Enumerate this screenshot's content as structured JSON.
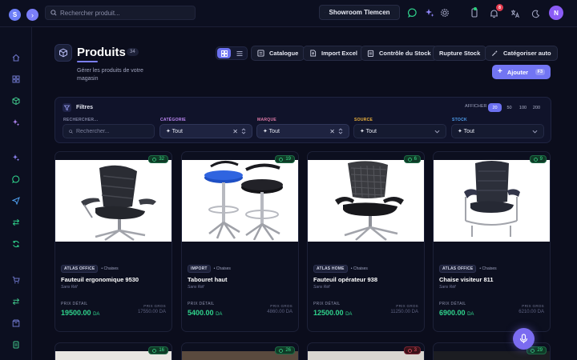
{
  "topbar": {
    "avatar_initial": "S",
    "search_placeholder": "Rechercher produit...",
    "showroom": "Showroom Tlemcen",
    "notifications_count": "8",
    "user_initial": "N"
  },
  "header": {
    "title": "Produits",
    "count": "34",
    "subtitle": "Gérer les produits de votre magasin",
    "buttons": [
      "Catalogue",
      "Import Excel",
      "Contrôle du Stock",
      "Rupture Stock",
      "Catégoriser auto"
    ],
    "add_label": "Ajouter",
    "add_shortcut": "F3"
  },
  "filters": {
    "title": "Filtres",
    "afficher_label": "AFFICHER",
    "per_page": [
      "20",
      "50",
      "100",
      "200"
    ],
    "per_page_selected": "20",
    "search_label": "RECHERCHER...",
    "search_placeholder": "Rechercher...",
    "categorie_label": "CATÉGORIE",
    "categorie_value": "✦ Tout",
    "marque_label": "MARQUE",
    "marque_value": "✦ Tout",
    "source_label": "SOURCE",
    "source_value": "✦ Tout",
    "stock_label": "STOCK",
    "stock_value": "✦ Tout"
  },
  "colors": {
    "accent": "#7275f3",
    "price": "#2fd38c",
    "categorie": "#c08af8",
    "marque": "#e07aa8",
    "source": "#f0b43c",
    "stock": "#4fa0f0"
  },
  "products": [
    {
      "stock": "32",
      "brand": "ATLAS OFFICE",
      "category": "• Chaises",
      "name": "Fauteuil ergonomique 9530",
      "ref": "Sans Réf",
      "price_label": "PRIX DÉTAIL",
      "price": "19500.00",
      "currency": "DA",
      "gros_label": "PRIX GROS",
      "gros": "17550.00 DA"
    },
    {
      "stock": "19",
      "brand": "IMPORT",
      "category": "• Chaises",
      "name": "Tabouret haut",
      "ref": "Sans Réf",
      "price_label": "PRIX DÉTAIL",
      "price": "5400.00",
      "currency": "DA",
      "gros_label": "PRIX GROS",
      "gros": "4860.00 DA"
    },
    {
      "stock": "6",
      "brand": "ATLAS HOME",
      "category": "• Chaises",
      "name": "Fauteuil opérateur 938",
      "ref": "Sans Réf",
      "price_label": "PRIX DÉTAIL",
      "price": "12500.00",
      "currency": "DA",
      "gros_label": "PRIX GROS",
      "gros": "11250.00 DA"
    },
    {
      "stock": "9",
      "brand": "ATLAS OFFICE",
      "category": "• Chaises",
      "name": "Chaise visiteur 811",
      "ref": "Sans Réf",
      "price_label": "PRIX DÉTAIL",
      "price": "6900.00",
      "currency": "DA",
      "gros_label": "PRIX GROS",
      "gros": "6210.00 DA"
    }
  ],
  "products_row2": [
    {
      "stock": "16"
    },
    {
      "stock": "26"
    },
    {
      "stock": "3"
    },
    {
      "stock": "29"
    }
  ]
}
